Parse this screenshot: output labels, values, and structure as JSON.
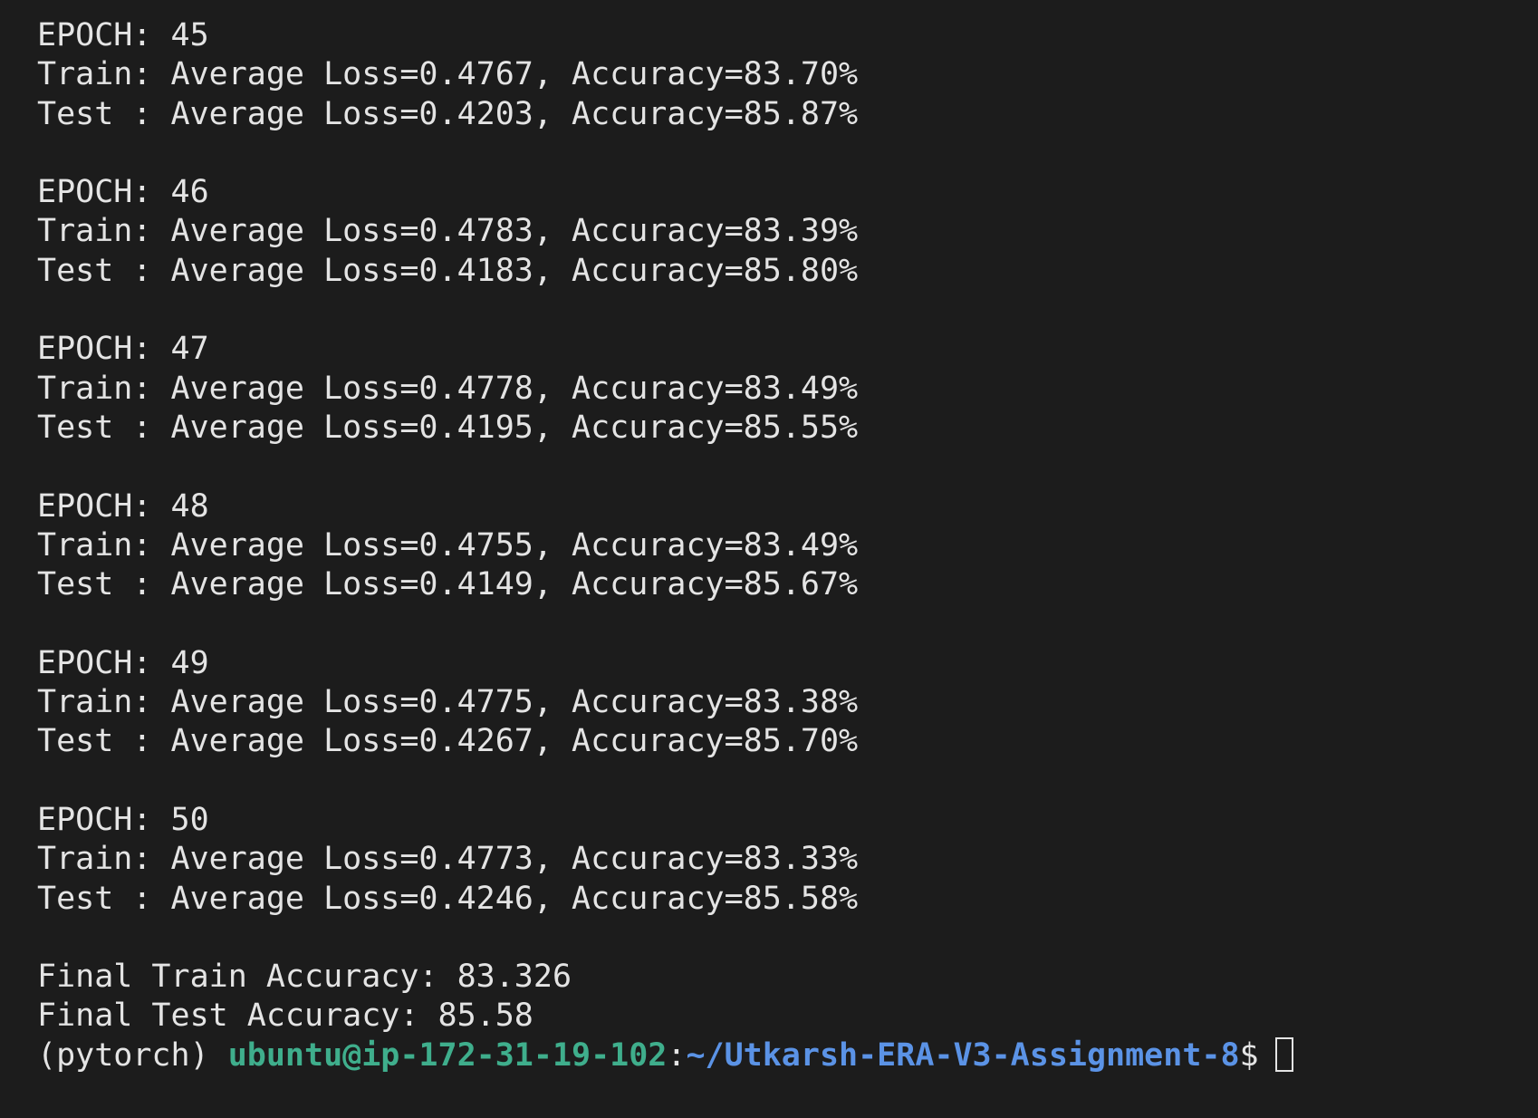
{
  "epochs": [
    {
      "header": "EPOCH: 45",
      "train": "Train: Average Loss=0.4767, Accuracy=83.70%",
      "test": "Test : Average Loss=0.4203, Accuracy=85.87%"
    },
    {
      "header": "EPOCH: 46",
      "train": "Train: Average Loss=0.4783, Accuracy=83.39%",
      "test": "Test : Average Loss=0.4183, Accuracy=85.80%"
    },
    {
      "header": "EPOCH: 47",
      "train": "Train: Average Loss=0.4778, Accuracy=83.49%",
      "test": "Test : Average Loss=0.4195, Accuracy=85.55%"
    },
    {
      "header": "EPOCH: 48",
      "train": "Train: Average Loss=0.4755, Accuracy=83.49%",
      "test": "Test : Average Loss=0.4149, Accuracy=85.67%"
    },
    {
      "header": "EPOCH: 49",
      "train": "Train: Average Loss=0.4775, Accuracy=83.38%",
      "test": "Test : Average Loss=0.4267, Accuracy=85.70%"
    },
    {
      "header": "EPOCH: 50",
      "train": "Train: Average Loss=0.4773, Accuracy=83.33%",
      "test": "Test : Average Loss=0.4246, Accuracy=85.58%"
    }
  ],
  "final": {
    "train": "Final Train Accuracy: 83.326",
    "test": "Final Test Accuracy: 85.58"
  },
  "prompt": {
    "env": "(pytorch) ",
    "user_host": "ubuntu@ip-172-31-19-102",
    "separator": ":",
    "path": "~/Utkarsh-ERA-V3-Assignment-8",
    "symbol": "$"
  },
  "colors": {
    "background": "#1c1c1c",
    "text": "#e4e4e4",
    "user_host": "#3fae8c",
    "path": "#5b93e6"
  }
}
